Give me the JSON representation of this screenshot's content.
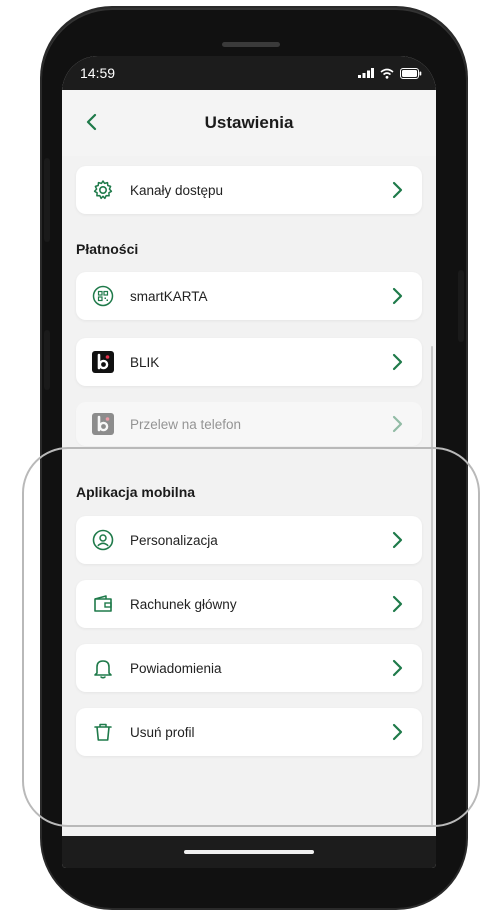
{
  "status_bar": {
    "time": "14:59"
  },
  "header": {
    "title": "Ustawienia"
  },
  "rows_top": [
    {
      "label": "Kanały dostępu",
      "icon": "gear-icon"
    }
  ],
  "sections": [
    {
      "title": "Płatności",
      "items": [
        {
          "label": "smartKARTA",
          "icon": "smartkarta-icon"
        },
        {
          "label": "BLIK",
          "icon": "blik-icon"
        },
        {
          "label": "Przelew na telefon",
          "icon": "phone-transfer-icon"
        }
      ]
    },
    {
      "title": "Aplikacja mobilna",
      "items": [
        {
          "label": "Personalizacja",
          "icon": "user-circle-icon"
        },
        {
          "label": "Rachunek główny",
          "icon": "wallet-icon"
        },
        {
          "label": "Powiadomienia",
          "icon": "bell-icon"
        },
        {
          "label": "Usuń profil",
          "icon": "trash-icon"
        }
      ]
    }
  ],
  "colors": {
    "accent": "#1f7a4a",
    "status_bar": "#1c1c1c",
    "background": "#f2f2f2"
  }
}
